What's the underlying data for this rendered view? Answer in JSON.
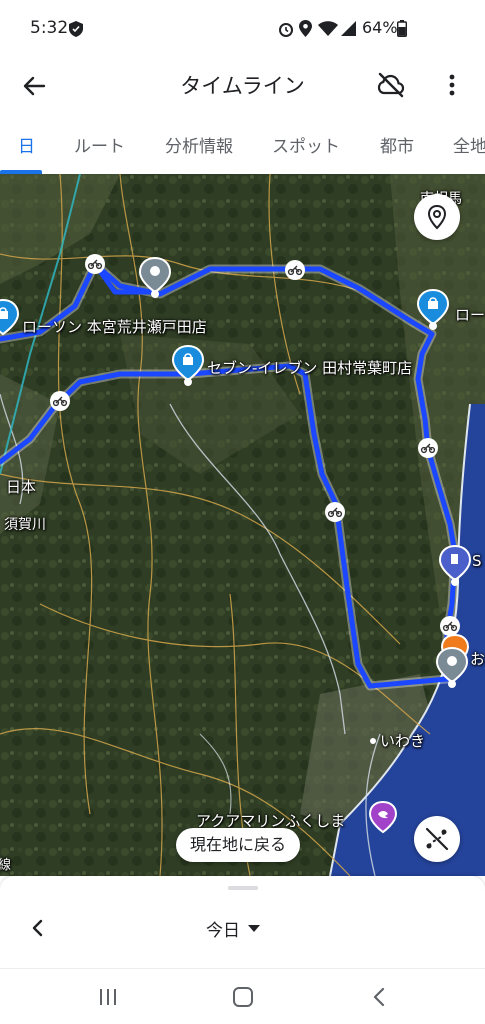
{
  "status_bar": {
    "time": "5:32",
    "battery_percent": "64%"
  },
  "app_bar": {
    "title": "タイムライン",
    "back_icon": "arrow-left-icon",
    "nosync_icon": "cloud-off-icon",
    "menu_icon": "more-vert-icon"
  },
  "tabs": [
    {
      "label": "日",
      "active": true
    },
    {
      "label": "ルート",
      "active": false
    },
    {
      "label": "分析情報",
      "active": false
    },
    {
      "label": "スポット",
      "active": false
    },
    {
      "label": "都市",
      "active": false
    },
    {
      "label": "全地",
      "active": false
    }
  ],
  "map": {
    "places": {
      "lawson_motomiya": "ローソン 本宮荒井瀬戸田店",
      "seven_tamura": "セブン-イレブン 田村常葉町店",
      "lawson_east": "ロー",
      "iwaki": "いわき",
      "aquamarine": "アクアマリンふくしま",
      "nihon": "日本",
      "sukagawa": "須賀川",
      "station_s": "S",
      "place_o": "お",
      "top_right": "南相馬",
      "left_edge": "線"
    },
    "route_color": "#1a47ff",
    "return_button_label": "現在地に戻る"
  },
  "bottom_sheet": {
    "date_label": "今日"
  }
}
